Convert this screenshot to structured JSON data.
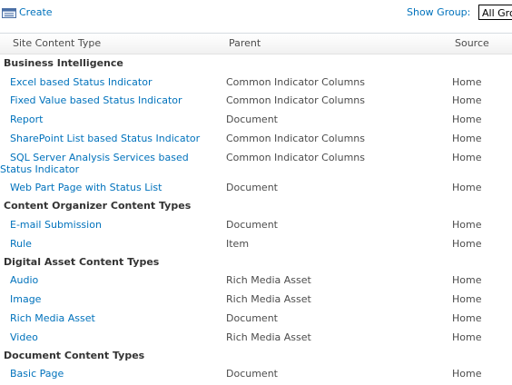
{
  "toolbar": {
    "create_label": "Create",
    "show_group_label": "Show Group:",
    "group_value": "All Gro"
  },
  "columns": {
    "name": "Site Content Type",
    "parent": "Parent",
    "source": "Source"
  },
  "groups": [
    {
      "title": "Business Intelligence",
      "items": [
        {
          "name": "Excel based Status Indicator",
          "parent": "Common Indicator Columns",
          "source": "Home"
        },
        {
          "name": "Fixed Value based Status Indicator",
          "parent": "Common Indicator Columns",
          "source": "Home"
        },
        {
          "name": "Report",
          "parent": "Document",
          "source": "Home"
        },
        {
          "name": "SharePoint List based Status Indicator",
          "parent": "Common Indicator Columns",
          "source": "Home"
        },
        {
          "name": "SQL Server Analysis Services based Status Indicator",
          "parent": "Common Indicator Columns",
          "source": "Home"
        },
        {
          "name": "Web Part Page with Status List",
          "parent": "Document",
          "source": "Home"
        }
      ]
    },
    {
      "title": "Content Organizer Content Types",
      "items": [
        {
          "name": "E-mail Submission",
          "parent": "Document",
          "source": "Home"
        },
        {
          "name": "Rule",
          "parent": "Item",
          "source": "Home"
        }
      ]
    },
    {
      "title": "Digital Asset Content Types",
      "items": [
        {
          "name": "Audio",
          "parent": "Rich Media Asset",
          "source": "Home"
        },
        {
          "name": "Image",
          "parent": "Rich Media Asset",
          "source": "Home"
        },
        {
          "name": "Rich Media Asset",
          "parent": "Document",
          "source": "Home"
        },
        {
          "name": "Video",
          "parent": "Rich Media Asset",
          "source": "Home"
        }
      ]
    },
    {
      "title": "Document Content Types",
      "items": [
        {
          "name": "Basic Page",
          "parent": "Document",
          "source": "Home"
        }
      ]
    }
  ]
}
